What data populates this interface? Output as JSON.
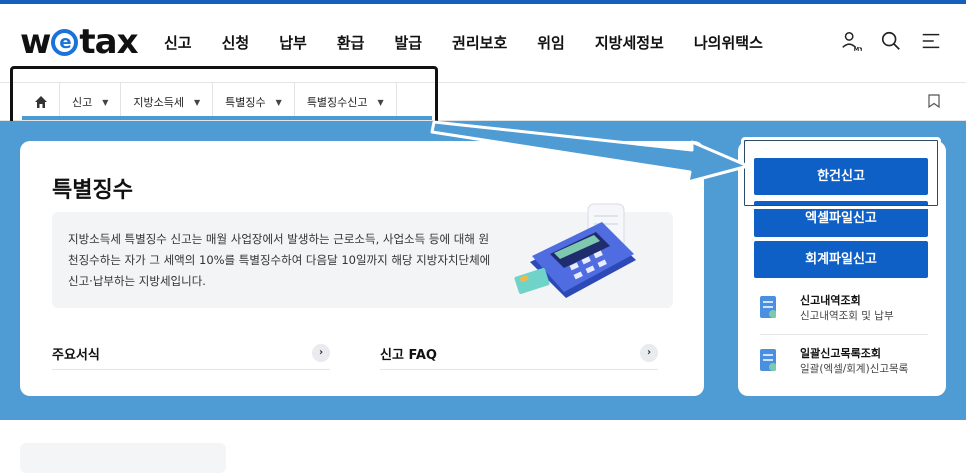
{
  "header": {
    "logo": "wetax",
    "nav": [
      "신고",
      "신청",
      "납부",
      "환급",
      "발급",
      "권리보호",
      "위임",
      "지방세정보",
      "나의위택스"
    ]
  },
  "breadcrumb": {
    "items": [
      "신고",
      "지방소득세",
      "특별징수",
      "특별징수신고"
    ]
  },
  "main": {
    "title": "특별징수",
    "description": "지방소득세 특별징수 신고는 매월 사업장에서 발생하는 근로소득, 사업소득 등에 대해 원천징수하는 자가 그 세액의 10%를 특별징수하여 다음달 10일까지 해당 지방자치단체에 신고·납부하는 지방세입니다.",
    "links": [
      "주요서식",
      "신고 FAQ"
    ]
  },
  "side": {
    "buttons": [
      "한건신고",
      "엑셀파일신고",
      "회계파일신고"
    ],
    "services": [
      {
        "title": "신고내역조회",
        "sub": "신고내역조회 및 납부"
      },
      {
        "title": "일괄신고목록조회",
        "sub": "일괄(엑셀/회계)신고목록"
      }
    ]
  },
  "colors": {
    "brand_blue": "#0e5fc6",
    "band": "#4f9bd4",
    "highlight_box": "#111111"
  }
}
